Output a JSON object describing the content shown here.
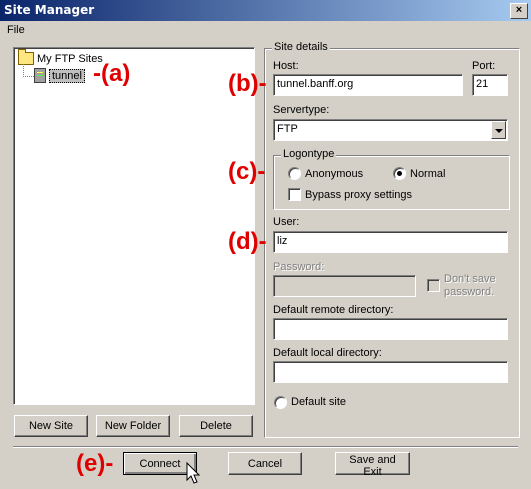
{
  "window": {
    "title": "Site Manager",
    "close_glyph": "×"
  },
  "menu": {
    "file": "File"
  },
  "tree": {
    "root_label": "My FTP Sites",
    "child_label": "tunnel"
  },
  "tree_buttons": {
    "new_site": "New Site",
    "new_folder": "New Folder",
    "delete": "Delete"
  },
  "site_details": {
    "group_label": "Site details",
    "host_label": "Host:",
    "host_value": "tunnel.banff.org",
    "port_label": "Port:",
    "port_value": "21",
    "servertype_label": "Servertype:",
    "servertype_value": "FTP",
    "logontype_label": "Logontype",
    "anonymous_label": "Anonymous",
    "normal_label": "Normal",
    "logontype_selected": "Normal",
    "bypass_proxy_label": "Bypass proxy settings",
    "user_label": "User:",
    "user_value": "liz",
    "password_label": "Password:",
    "password_value": "",
    "dont_save_label_1": "Don't save",
    "dont_save_label_2": "password.",
    "remote_dir_label": "Default remote directory:",
    "remote_dir_value": "",
    "local_dir_label": "Default local directory:",
    "local_dir_value": "",
    "default_site_label": "Default site"
  },
  "footer": {
    "connect": "Connect",
    "cancel": "Cancel",
    "save_exit": "Save and Exit"
  },
  "annotations": {
    "a": "-(a)",
    "b": "(b)-",
    "c": "(c)-",
    "d": "(d)-",
    "e": "(e)-"
  },
  "colors": {
    "annotation": "#e00000",
    "title_bar": "#0a246a",
    "dialog_bg": "#d4d0c8"
  },
  "icons": [
    "folder-icon",
    "server-icon",
    "close-icon",
    "dropdown-arrow-icon",
    "mouse-cursor-icon"
  ]
}
